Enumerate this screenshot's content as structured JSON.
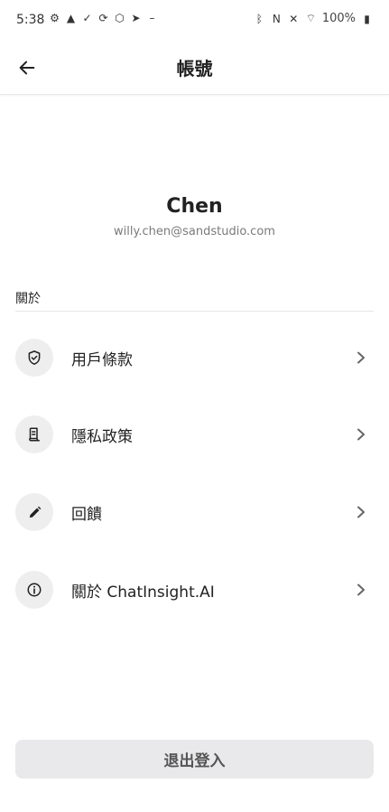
{
  "status_bar": {
    "time": "5:38",
    "battery": "100%",
    "icons_left": [
      "gear-icon",
      "warning-icon",
      "check-icon",
      "sync-icon",
      "shield-icon",
      "send-icon",
      "minus-icon"
    ],
    "icons_right": [
      "bluetooth-icon",
      "nfc-icon",
      "mute-icon",
      "wifi-icon",
      "battery-icon"
    ]
  },
  "header": {
    "title": "帳號"
  },
  "profile": {
    "name": "Chen",
    "email": "willy.chen@sandstudio.com"
  },
  "section": {
    "label": "關於"
  },
  "menu": {
    "items": [
      {
        "label": "用戶條款",
        "icon": "shield-check-icon"
      },
      {
        "label": "隱私政策",
        "icon": "document-icon"
      },
      {
        "label": "回饋",
        "icon": "pencil-icon"
      },
      {
        "label": "關於 ChatInsight.AI",
        "icon": "info-icon"
      }
    ]
  },
  "logout": {
    "label": "退出登入"
  }
}
